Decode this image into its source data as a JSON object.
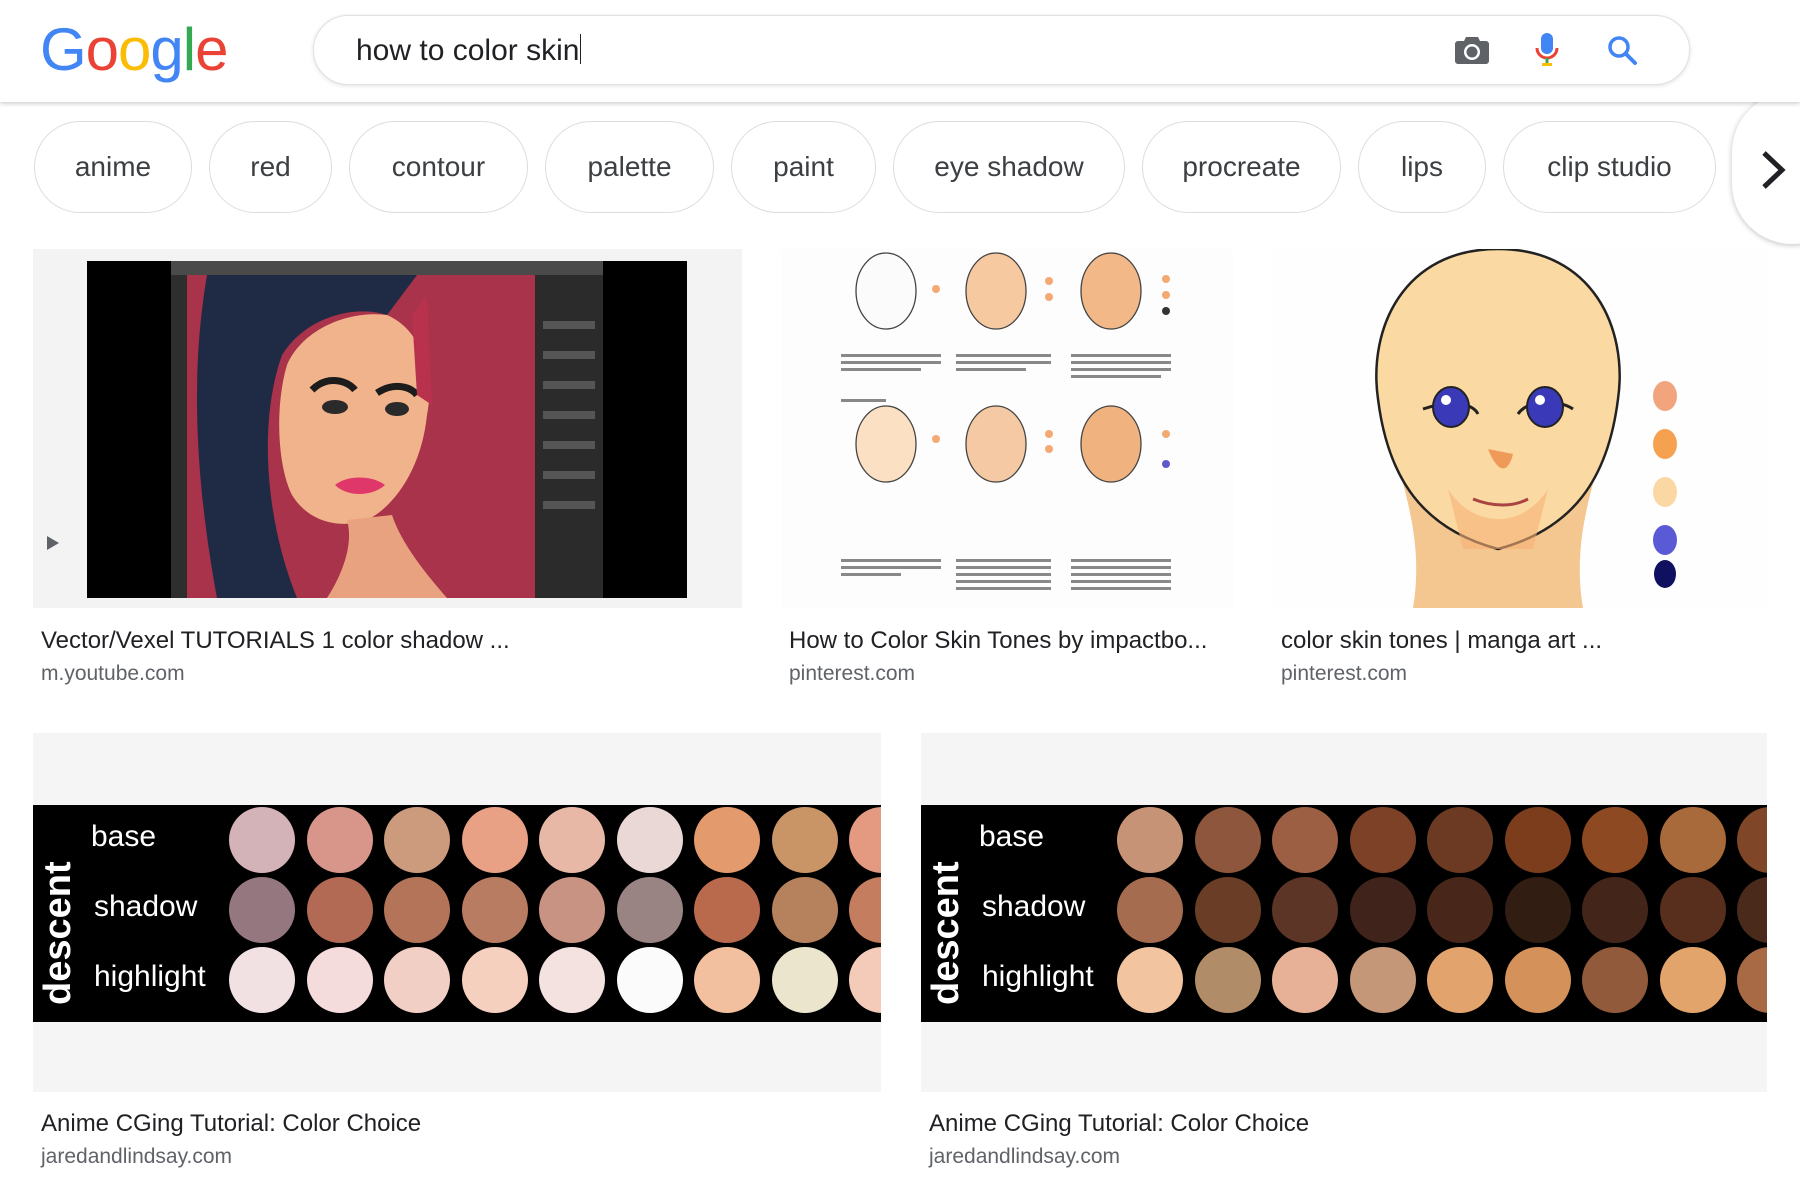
{
  "header": {
    "logo_letters": [
      {
        "ch": "G",
        "color": "#4285F4"
      },
      {
        "ch": "o",
        "color": "#EA4335"
      },
      {
        "ch": "o",
        "color": "#FBBC05"
      },
      {
        "ch": "g",
        "color": "#4285F4"
      },
      {
        "ch": "l",
        "color": "#34A853"
      },
      {
        "ch": "e",
        "color": "#EA4335"
      }
    ],
    "search_value": "how to color skin",
    "icons": [
      "camera-icon",
      "microphone-icon",
      "search-icon"
    ]
  },
  "chips": [
    "anime",
    "red",
    "contour",
    "palette",
    "paint",
    "eye shadow",
    "procreate",
    "lips",
    "clip studio"
  ],
  "results": [
    {
      "title": "Vector/Vexel TUTORIALS 1 color shadow ...",
      "source": "m.youtube.com"
    },
    {
      "title": "How to Color Skin Tones by impactbo...",
      "source": "pinterest.com"
    },
    {
      "title": "color skin tones | manga art ...",
      "source": "pinterest.com"
    },
    {
      "title": "Anime CGing Tutorial: Color Choice",
      "source": "jaredandlindsay.com"
    },
    {
      "title": "Anime CGing Tutorial: Color Choice",
      "source": "jaredandlindsay.com"
    }
  ],
  "palette_labels": {
    "side": "descent",
    "rows": [
      "base",
      "shadow",
      "highlight"
    ]
  },
  "palette_a": [
    [
      "#d4b3b8",
      "#d8968a",
      "#cc9a7c",
      "#e8a184",
      "#e8b8a7",
      "#ead8d6",
      "#e39a6c",
      "#c99566",
      "#e49a80"
    ],
    [
      "#957780",
      "#b26a55",
      "#b3745a",
      "#b87c62",
      "#c99384",
      "#9a8383",
      "#b96a4c",
      "#b6825d",
      "#c57d5f"
    ],
    [
      "#f1e1e2",
      "#f3dcdb",
      "#f1cfc4",
      "#f6d0be",
      "#f3e2e0",
      "#fbfbfb",
      "#f2c09f",
      "#ebe5cd",
      "#f4cbb8"
    ]
  ],
  "palette_b": [
    [
      "#c69377",
      "#8e573d",
      "#9c5f44",
      "#7c4127",
      "#6c3a22",
      "#7b3d1b",
      "#8d4a22",
      "#a8693b",
      "#7f4727"
    ],
    [
      "#a66c50",
      "#6a3e26",
      "#5c3526",
      "#40231a",
      "#48271a",
      "#321d12",
      "#44251a",
      "#582e1c",
      "#4a2a1b"
    ],
    [
      "#f2c4a0",
      "#b08d68",
      "#e7b197",
      "#c39777",
      "#e3a36d",
      "#d4915a",
      "#915a3a",
      "#e2a46b",
      "#a76a44"
    ]
  ]
}
